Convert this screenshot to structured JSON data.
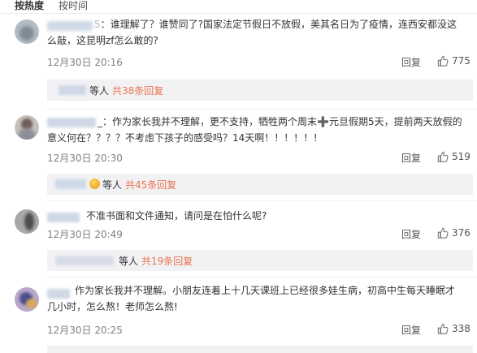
{
  "sort": {
    "hot": "按热度",
    "time": "按时间"
  },
  "comments": [
    {
      "name_suffix": "5",
      "text": "：谁理解了？谁赞同了?国家法定节假日不放假，美其名日为了疫情，连西安都没这么敲，这昆明zf怎么敢的?",
      "time": "12月30日 20:16",
      "reply": "回复",
      "likes": "775",
      "sub": {
        "deng": "等人",
        "more": "共38条回复"
      }
    },
    {
      "name_suffix": "_",
      "text": "：作为家长我并不理解，更不支持，牺牲两个周末➕元旦假期5天，提前两天放假的意义何在？？？？不考虑下孩子的感受吗？14天啊！！！！！！",
      "time": "12月30日 20:30",
      "reply": "回复",
      "likes": "519",
      "sub": {
        "deng": "等人",
        "more": "共45条回复"
      }
    },
    {
      "name_suffix": "",
      "text": "不准书面和文件通知，请问是在怕什么呢?",
      "time": "12月30日 20:49",
      "reply": "回复",
      "likes": "376",
      "sub": {
        "deng": "等人",
        "more": "共19条回复"
      }
    },
    {
      "name_suffix": "",
      "text": "作为家长我并不理解。小朋友连着上十几天课班上已经很多娃生病，初高中生每天睡眠才几小时，怎么熬！老师怎么熬!",
      "time": "12月30日 20:25",
      "reply": "回复",
      "likes": "338"
    }
  ],
  "colors": {
    "link": "#eb7350",
    "subbg": "#f2f2f5",
    "muted": "#808080"
  },
  "icons": {
    "like": "thumbs-up-icon"
  }
}
